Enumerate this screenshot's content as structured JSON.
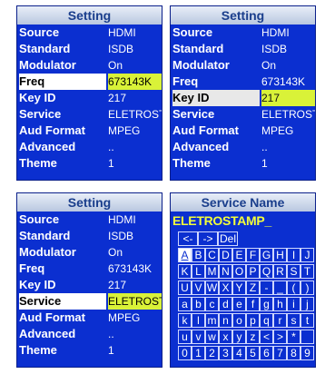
{
  "panels": [
    {
      "title": "Setting",
      "rows": [
        {
          "label": "Source",
          "value": "HDMI"
        },
        {
          "label": "Standard",
          "value": "ISDB"
        },
        {
          "label": "Modulator",
          "value": "On"
        },
        {
          "label": "Freq",
          "value": "673143K"
        },
        {
          "label": "Key ID",
          "value": "217"
        },
        {
          "label": "Service",
          "value": "ELETROST."
        },
        {
          "label": "Aud Format",
          "value": "MPEG"
        },
        {
          "label": "Advanced",
          "value": ".."
        },
        {
          "label": "Theme",
          "value": "1"
        }
      ]
    },
    {
      "title": "Setting",
      "rows": [
        {
          "label": "Source",
          "value": "HDMI"
        },
        {
          "label": "Standard",
          "value": "ISDB"
        },
        {
          "label": "Modulator",
          "value": "On"
        },
        {
          "label": "Freq",
          "value": "673143K"
        },
        {
          "label": "Key ID",
          "value": "217"
        },
        {
          "label": "Service",
          "value": "ELETROST."
        },
        {
          "label": "Aud Format",
          "value": "MPEG"
        },
        {
          "label": "Advanced",
          "value": ".."
        },
        {
          "label": "Theme",
          "value": "1"
        }
      ]
    },
    {
      "title": "Setting",
      "rows": [
        {
          "label": "Source",
          "value": "HDMI"
        },
        {
          "label": "Standard",
          "value": "ISDB"
        },
        {
          "label": "Modulator",
          "value": "On"
        },
        {
          "label": "Freq",
          "value": "673143K"
        },
        {
          "label": "Key ID",
          "value": "217"
        },
        {
          "label": "Service",
          "value": "ELETROST."
        },
        {
          "label": "Aud Format",
          "value": "MPEG"
        },
        {
          "label": "Advanced",
          "value": ".."
        },
        {
          "label": "Theme",
          "value": "1"
        }
      ]
    }
  ],
  "keyboard": {
    "title": "Service Name",
    "entry": "ELETROSTAMP_",
    "rows": [
      [
        "<-",
        "->",
        "Del"
      ],
      [
        "A",
        "B",
        "C",
        "D",
        "E",
        "F",
        "G",
        "H",
        "I",
        "J"
      ],
      [
        "K",
        "L",
        "M",
        "N",
        "O",
        "P",
        "Q",
        "R",
        "S",
        "T"
      ],
      [
        "U",
        "V",
        "W",
        "X",
        "Y",
        "Z",
        "-",
        "_",
        "(",
        ")"
      ],
      [
        "a",
        "b",
        "c",
        "d",
        "e",
        "f",
        "g",
        "h",
        "i",
        "j"
      ],
      [
        "k",
        "l",
        "m",
        "n",
        "o",
        "p",
        "q",
        "r",
        "s",
        "t"
      ],
      [
        "u",
        "v",
        "w",
        "x",
        "y",
        "z",
        "<",
        ">",
        "*",
        ""
      ],
      [
        "0",
        "1",
        "2",
        "3",
        "4",
        "5",
        "6",
        "7",
        "8",
        "9"
      ]
    ]
  },
  "colors": {
    "screen_bg": "#0b2fd0",
    "highlight": "#d9f238",
    "title_text": "#1a3e8c",
    "entry_text": "#f3ff3a"
  }
}
